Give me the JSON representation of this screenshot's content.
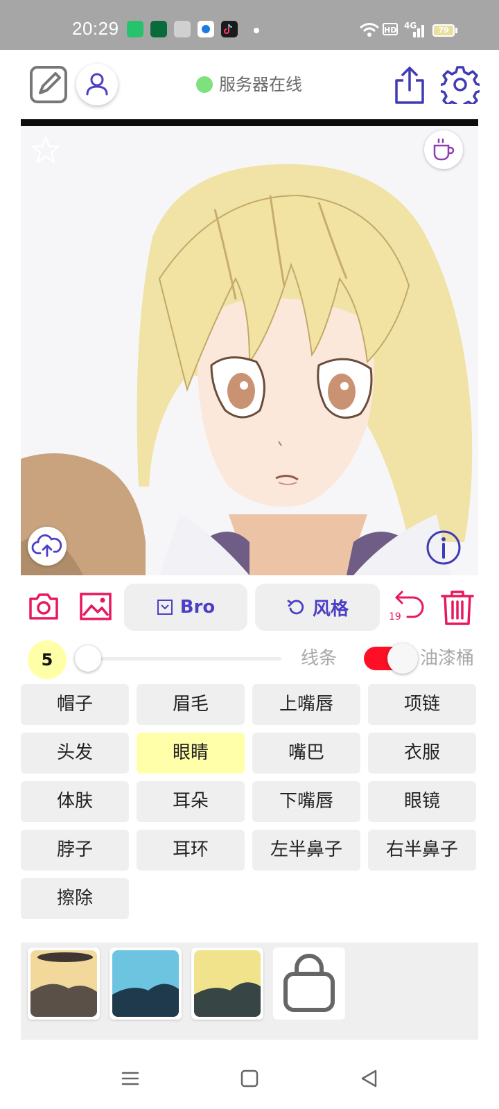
{
  "status_bar": {
    "time": "20:29",
    "apps": [
      {
        "icon": "app-icon-green",
        "color": "#27c26c"
      },
      {
        "icon": "oppo-icon",
        "color": "#0a6b3a"
      },
      {
        "icon": "paw-icon",
        "color": "#cfcfcf"
      },
      {
        "icon": "app-icon-blue",
        "color": "#1e7be6"
      },
      {
        "icon": "tiktok-icon",
        "color": "#1a1a1a"
      }
    ],
    "network_badge": "HD",
    "network_type": "4G",
    "battery": "79"
  },
  "toolbar": {
    "server_status": "服务器在线",
    "server_status_color": "#7ee17e",
    "icons": [
      "edit-icon",
      "user-icon",
      "share-icon",
      "gear-icon"
    ],
    "accent": "#4a3fc6"
  },
  "canvas": {
    "icons": [
      "star-icon",
      "coffee-icon",
      "cloud-upload-icon",
      "info-icon"
    ]
  },
  "controls": {
    "brush_label": "Bro",
    "style_label": "风格",
    "undo_count": "19",
    "accent_red": "#e8185c"
  },
  "slider": {
    "size": "5",
    "value": 0,
    "line_label": "线条",
    "bucket_label": "油漆桶",
    "bucket_on": true
  },
  "parts": [
    "帽子",
    "眉毛",
    "上嘴唇",
    "项链",
    "头发",
    "眼睛",
    "嘴巴",
    "衣服",
    "体肤",
    "耳朵",
    "下嘴唇",
    "眼镜",
    "脖子",
    "耳环",
    "左半鼻子",
    "右半鼻子",
    "擦除"
  ],
  "active_part": "眼睛",
  "swatches": [
    {
      "bg": "#f2d89b",
      "fg": "#5a5048"
    },
    {
      "bg": "#6cc4e0",
      "fg": "#1e3a4c"
    },
    {
      "bg": "#f0e38c",
      "fg": "#374544"
    }
  ],
  "nav": {
    "icons": [
      "menu-icon",
      "home-icon",
      "back-icon"
    ]
  }
}
